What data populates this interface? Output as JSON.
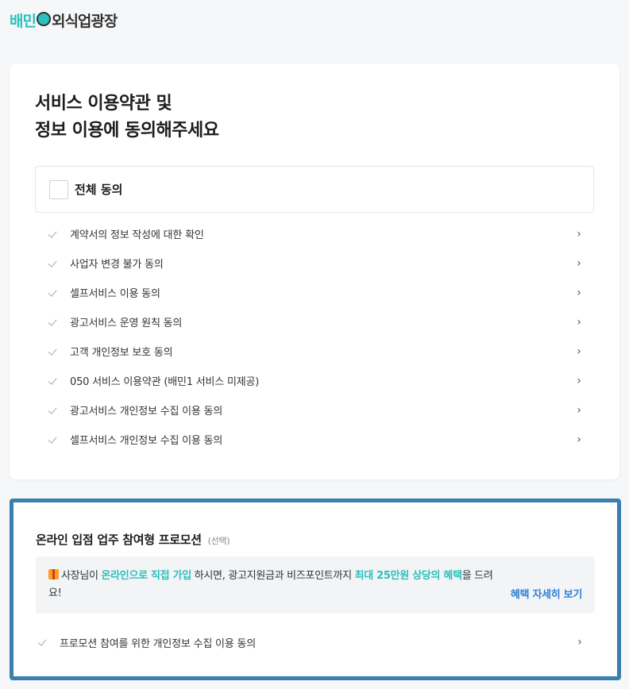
{
  "logo": {
    "brand": "배민",
    "rest": "외식업광장"
  },
  "header": {
    "title_line1": "서비스 이용약관 및",
    "title_line2": "정보 이용에 동의해주세요"
  },
  "all_agree": {
    "label": "전체 동의",
    "checked": false
  },
  "terms": [
    {
      "label": "계약서의 정보 작성에 대한 확인"
    },
    {
      "label": "사업자 변경 불가 동의"
    },
    {
      "label": "셀프서비스 이용 동의"
    },
    {
      "label": "광고서비스 운영 원칙 동의"
    },
    {
      "label": "고객 개인정보 보호 동의"
    },
    {
      "label": "050 서비스 이용약관 (배민1 서비스 미제공)"
    },
    {
      "label": "광고서비스 개인정보 수집 이용 동의"
    },
    {
      "label": "셀프서비스 개인정보 수집 이용 동의"
    }
  ],
  "promo": {
    "title": "온라인 입점 업주 참여형 프로모션",
    "optional": "(선택)",
    "text_1": "사장님이 ",
    "highlight_1": "온라인으로 직접 가입",
    "text_2": " 하시면, 광고지원금과 비즈포인트까지 ",
    "highlight_2": "최대 25만원 상당의 혜택",
    "text_3": "을 드려요!",
    "detail_link": "혜택 자세히 보기",
    "term_label": "프로모션 참여를 위한 개인정보 수집 이용 동의"
  },
  "icons": {
    "check": "check-icon",
    "chevron": "chevron-right-icon",
    "gift": "gift-icon"
  },
  "colors": {
    "accent": "#2ac1bc",
    "link": "#2f80d7",
    "highlight_border": "#3a7fae"
  }
}
